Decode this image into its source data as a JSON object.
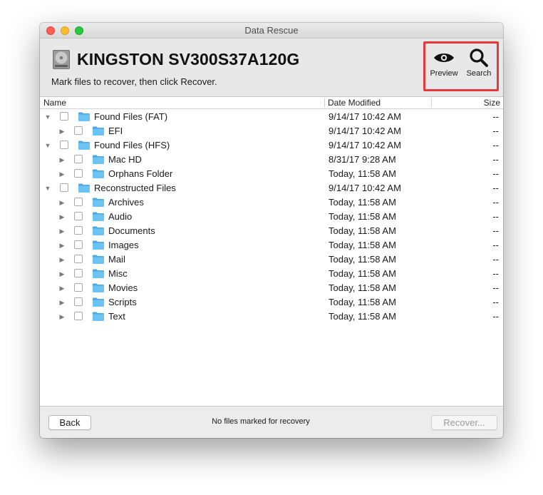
{
  "window": {
    "title": "Data Rescue"
  },
  "header": {
    "drive_name": "KINGSTON SV300S37A120G",
    "instruction": "Mark files to recover, then click Recover.",
    "tools": {
      "preview_label": "Preview",
      "search_label": "Search"
    },
    "highlight_color": "#e8383b"
  },
  "columns": {
    "name": "Name",
    "date_modified": "Date Modified",
    "size": "Size"
  },
  "rows": [
    {
      "name": "Found Files (FAT)",
      "date": "9/14/17 10:42 AM",
      "size": "--",
      "level": 0,
      "expanded": true
    },
    {
      "name": "EFI",
      "date": "9/14/17 10:42 AM",
      "size": "--",
      "level": 1,
      "expanded": false
    },
    {
      "name": "Found Files (HFS)",
      "date": "9/14/17 10:42 AM",
      "size": "--",
      "level": 0,
      "expanded": true
    },
    {
      "name": "Mac HD",
      "date": "8/31/17 9:28 AM",
      "size": "--",
      "level": 1,
      "expanded": false
    },
    {
      "name": "Orphans Folder",
      "date": "Today, 11:58 AM",
      "size": "--",
      "level": 1,
      "expanded": false
    },
    {
      "name": "Reconstructed Files",
      "date": "9/14/17 10:42 AM",
      "size": "--",
      "level": 0,
      "expanded": true
    },
    {
      "name": "Archives",
      "date": "Today, 11:58 AM",
      "size": "--",
      "level": 1,
      "expanded": false
    },
    {
      "name": "Audio",
      "date": "Today, 11:58 AM",
      "size": "--",
      "level": 1,
      "expanded": false
    },
    {
      "name": "Documents",
      "date": "Today, 11:58 AM",
      "size": "--",
      "level": 1,
      "expanded": false
    },
    {
      "name": "Images",
      "date": "Today, 11:58 AM",
      "size": "--",
      "level": 1,
      "expanded": false
    },
    {
      "name": "Mail",
      "date": "Today, 11:58 AM",
      "size": "--",
      "level": 1,
      "expanded": false
    },
    {
      "name": "Misc",
      "date": "Today, 11:58 AM",
      "size": "--",
      "level": 1,
      "expanded": false
    },
    {
      "name": "Movies",
      "date": "Today, 11:58 AM",
      "size": "--",
      "level": 1,
      "expanded": false
    },
    {
      "name": "Scripts",
      "date": "Today, 11:58 AM",
      "size": "--",
      "level": 1,
      "expanded": false
    },
    {
      "name": "Text",
      "date": "Today, 11:58 AM",
      "size": "--",
      "level": 1,
      "expanded": false
    }
  ],
  "footer": {
    "back_label": "Back",
    "status": "No files marked for recovery",
    "recover_label": "Recover..."
  },
  "icons": {
    "disk": "hard-drive-icon",
    "preview": "eye-icon",
    "search": "magnifier-icon",
    "folder": "folder-icon",
    "expanded": "disclosure-down-icon",
    "collapsed": "disclosure-right-icon"
  },
  "colors": {
    "folder": "#6cc4f5"
  }
}
